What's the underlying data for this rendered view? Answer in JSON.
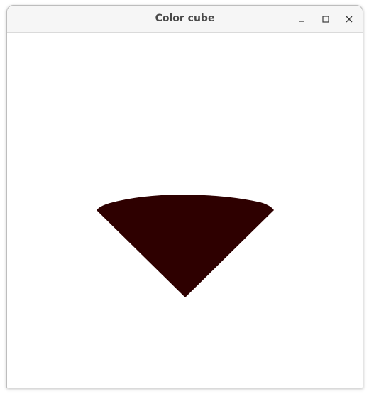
{
  "window": {
    "title": "Color cube"
  },
  "controls": {
    "minimize_icon": "minimize-icon",
    "maximize_icon": "maximize-icon",
    "close_icon": "close-icon"
  },
  "scene": {
    "shape_color": "#2e0000",
    "background_color": "#ffffff"
  }
}
